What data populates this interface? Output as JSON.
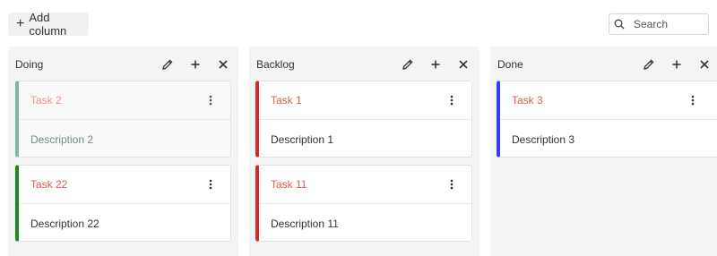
{
  "toolbar": {
    "add_column_label": "Add column",
    "search_placeholder": "Search"
  },
  "columns": [
    {
      "title": "Doing",
      "cards": [
        {
          "title": "Task 2",
          "description": "Description 2",
          "color": "#7fb5a9",
          "faded": true
        },
        {
          "title": "Task 22",
          "description": "Description 22",
          "color": "#1a8a1a"
        }
      ]
    },
    {
      "title": "Backlog",
      "cards": [
        {
          "title": "Task 1",
          "description": "Description 1",
          "color": "#e02424"
        },
        {
          "title": "Task 11",
          "description": "Description 11",
          "color": "#e02424"
        }
      ]
    },
    {
      "title": "Done",
      "cards": [
        {
          "title": "Task 3",
          "description": "Description 3",
          "color": "#3b3bf0"
        }
      ]
    }
  ],
  "colors": {
    "card_title": "#e05a4f",
    "column_bg": "#f4f4f4"
  }
}
